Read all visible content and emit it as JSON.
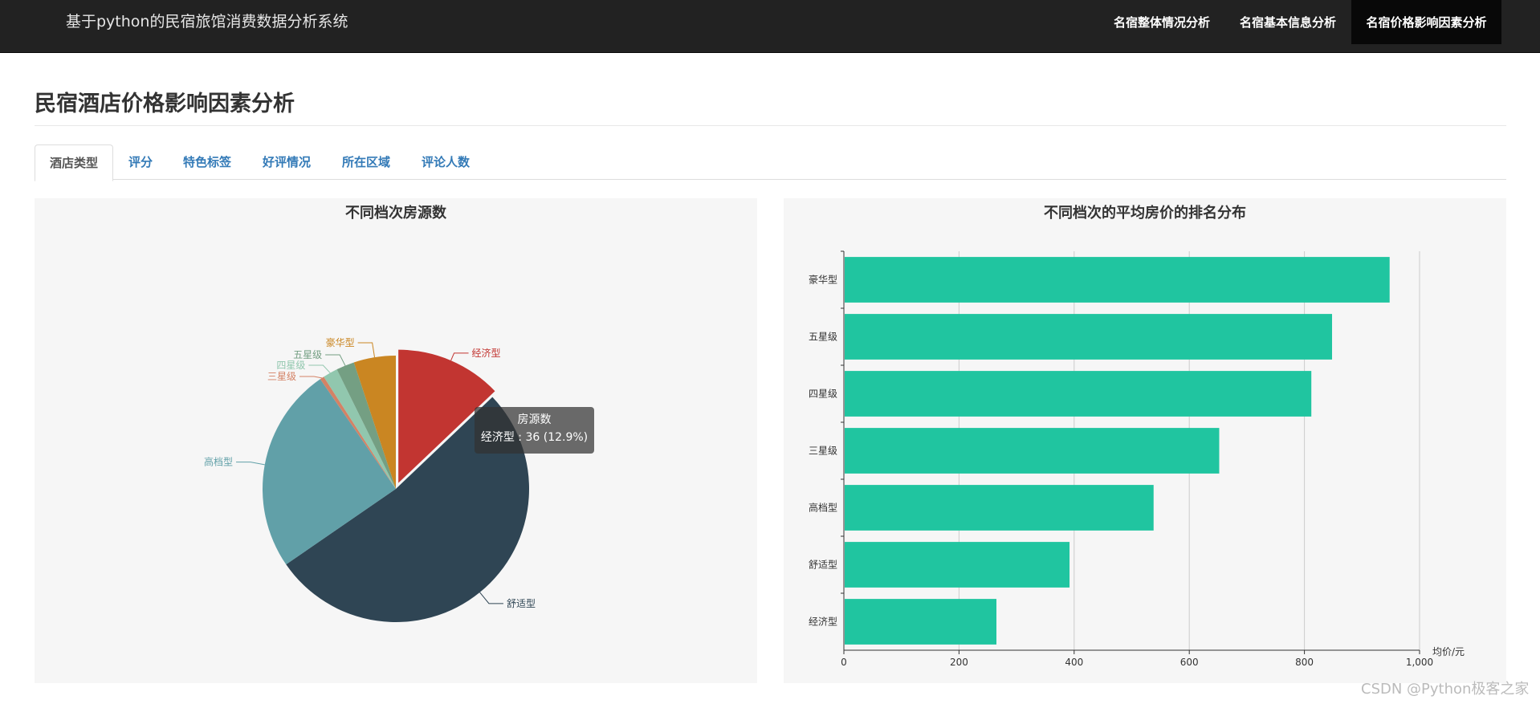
{
  "navbar": {
    "brand": "基于python的民宿旅馆消费数据分析系统",
    "items": [
      {
        "label": "名宿整体情况分析"
      },
      {
        "label": "名宿基本信息分析"
      },
      {
        "label": "名宿价格影响因素分析"
      }
    ]
  },
  "page": {
    "title": "民宿酒店价格影响因素分析"
  },
  "tabs": [
    {
      "label": "酒店类型"
    },
    {
      "label": "评分"
    },
    {
      "label": "特色标签"
    },
    {
      "label": "好评情况"
    },
    {
      "label": "所在区域"
    },
    {
      "label": "评论人数"
    }
  ],
  "tooltip": {
    "title": "房源数",
    "text": "经济型 : 36 (12.9%)"
  },
  "watermark": "CSDN @Python极客之家",
  "chart_data": [
    {
      "type": "pie",
      "title": "不同档次房源数",
      "series_name": "房源数",
      "slices": [
        {
          "label": "经济型",
          "percent": 12.9,
          "color": "#c23531"
        },
        {
          "label": "舒适型",
          "percent": 52.5,
          "color": "#2f4554"
        },
        {
          "label": "高档型",
          "percent": 25.0,
          "color": "#61a0a8"
        },
        {
          "label": "三星级",
          "percent": 0.5,
          "color": "#d48265"
        },
        {
          "label": "四星级",
          "percent": 1.8,
          "color": "#91c7ae"
        },
        {
          "label": "五星级",
          "percent": 2.2,
          "color": "#749f83"
        },
        {
          "label": "豪华型",
          "percent": 5.1,
          "color": "#ca8622"
        }
      ]
    },
    {
      "type": "bar",
      "orientation": "horizontal",
      "title": "不同档次的平均房价的排名分布",
      "categories": [
        "豪华型",
        "五星级",
        "四星级",
        "三星级",
        "高档型",
        "舒适型",
        "经济型"
      ],
      "values": [
        948,
        848,
        812,
        652,
        538,
        392,
        265
      ],
      "xlabel": "均价/元",
      "xlim": [
        0,
        1000
      ],
      "xticks": [
        "0",
        "200",
        "400",
        "600",
        "800",
        "1,000"
      ],
      "grid": true,
      "color": "#20c5a0"
    }
  ]
}
